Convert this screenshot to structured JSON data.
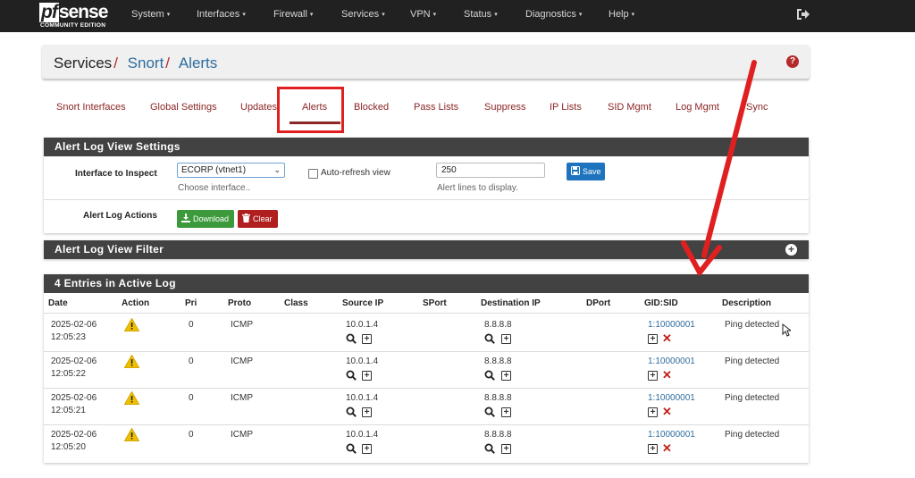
{
  "nav": {
    "logo_main": "sense",
    "logo_pf": "pf",
    "logo_sub": "COMMUNITY EDITION",
    "items": [
      "System",
      "Interfaces",
      "Firewall",
      "Services",
      "VPN",
      "Status",
      "Diagnostics",
      "Help"
    ],
    "caret": "▾",
    "logout_icon": "logout-icon"
  },
  "breadcrumb": {
    "root": "Services",
    "sep": "/",
    "level1": "Snort",
    "level2": "Alerts",
    "help_glyph": "?"
  },
  "tabs": [
    "Snort Interfaces",
    "Global Settings",
    "Updates",
    "Alerts",
    "Blocked",
    "Pass Lists",
    "Suppress",
    "IP Lists",
    "SID Mgmt",
    "Log Mgmt",
    "Sync"
  ],
  "active_tab": "Alerts",
  "settings": {
    "title": "Alert Log View Settings",
    "interface_label": "Interface to Inspect",
    "interface_value": "ECORP (vtnet1)",
    "interface_hint": "Choose interface..",
    "autorefresh_label": "Auto-refresh view",
    "lines_value": "250",
    "lines_hint": "Alert lines to display.",
    "save_label": "Save",
    "actions_label": "Alert Log Actions",
    "download_label": "Download",
    "clear_label": "Clear"
  },
  "filter": {
    "title": "Alert Log View Filter",
    "toggle_glyph": "+"
  },
  "log": {
    "title": "4 Entries in Active Log",
    "columns": [
      "Date",
      "Action",
      "Pri",
      "Proto",
      "Class",
      "Source IP",
      "SPort",
      "Destination IP",
      "DPort",
      "GID:SID",
      "Description"
    ],
    "rows": [
      {
        "date": "2025-02-06",
        "time": "12:05:23",
        "pri": "0",
        "proto": "ICMP",
        "src": "10.0.1.4",
        "dst": "8.8.8.8",
        "sid": "1:10000001",
        "desc": "Ping detected"
      },
      {
        "date": "2025-02-06",
        "time": "12:05:22",
        "pri": "0",
        "proto": "ICMP",
        "src": "10.0.1.4",
        "dst": "8.8.8.8",
        "sid": "1:10000001",
        "desc": "Ping detected"
      },
      {
        "date": "2025-02-06",
        "time": "12:05:21",
        "pri": "0",
        "proto": "ICMP",
        "src": "10.0.1.4",
        "dst": "8.8.8.8",
        "sid": "1:10000001",
        "desc": "Ping detected"
      },
      {
        "date": "2025-02-06",
        "time": "12:05:20",
        "pri": "0",
        "proto": "ICMP",
        "src": "10.0.1.4",
        "dst": "8.8.8.8",
        "sid": "1:10000001",
        "desc": "Ping detected"
      }
    ]
  },
  "colors": {
    "navbar": "#212121",
    "tab_text": "#8c2525",
    "link": "#2f6d9e",
    "panel_header": "#424242",
    "save_button": "#1e73be",
    "download_button": "#3c9a3c",
    "clear_button": "#b01f1f",
    "annotation_red": "#e02020",
    "warning_yellow": "#f0c000"
  }
}
